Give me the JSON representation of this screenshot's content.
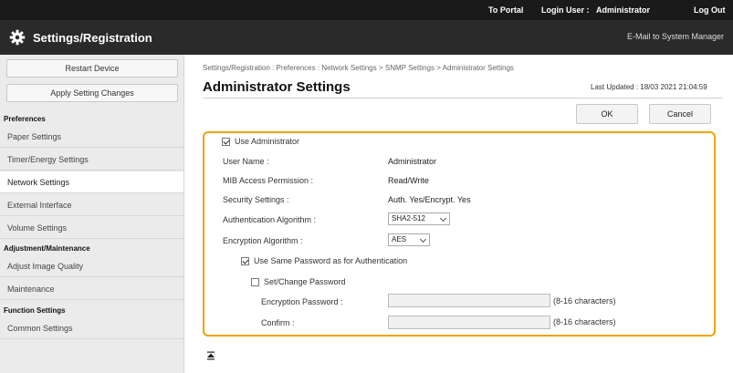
{
  "topbar": {
    "portal_link": "To Portal",
    "login_user_label": "Login User :",
    "login_user_name": "Administrator",
    "logout_link": "Log Out"
  },
  "titlebar": {
    "title": "Settings/Registration",
    "email_link": "E-Mail to System Manager"
  },
  "sidebar": {
    "restart_button": "Restart Device",
    "apply_button": "Apply Setting Changes",
    "categories": [
      {
        "label": "Preferences",
        "items": [
          "Paper Settings",
          "Timer/Energy Settings",
          "Network Settings",
          "External Interface",
          "Volume Settings"
        ]
      },
      {
        "label": "Adjustment/Maintenance",
        "items": [
          "Adjust Image Quality",
          "Maintenance"
        ]
      },
      {
        "label": "Function Settings",
        "items": [
          "Common Settings"
        ]
      }
    ],
    "active_item": "Network Settings"
  },
  "main": {
    "breadcrumb": "Settings/Registration : Preferences : Network Settings > SNMP Settings > Administrator Settings",
    "title": "Administrator Settings",
    "last_updated": "Last Updated : 18/03 2021 21:04:59",
    "ok_button": "OK",
    "cancel_button": "Cancel"
  },
  "form": {
    "use_admin_label": "Use Administrator",
    "use_admin_checked": true,
    "user_name_label": "User Name :",
    "user_name_value": "Administrator",
    "mib_label": "MIB Access Permission :",
    "mib_value": "Read/Write",
    "security_label": "Security Settings :",
    "security_value": "Auth. Yes/Encrypt. Yes",
    "auth_algo_label": "Authentication Algorithm :",
    "auth_algo_value": "SHA2-512",
    "enc_algo_label": "Encryption Algorithm :",
    "enc_algo_value": "AES",
    "same_pw_label": "Use Same Password as for Authentication",
    "same_pw_checked": true,
    "set_change_pw_label": "Set/Change Password",
    "set_change_pw_checked": false,
    "enc_pw_label": "Encryption Password :",
    "enc_pw_value": "",
    "enc_pw_hint": "(8-16 characters)",
    "confirm_label": "Confirm :",
    "confirm_value": "",
    "confirm_hint": "(8-16 characters)"
  },
  "icons": {
    "app_icon": "gear-icon",
    "scroll_top_icon": "scroll-to-top-icon"
  },
  "colors": {
    "highlight_border": "#f0a400",
    "topbar_bg": "#1a1a1a",
    "titlebar_bg": "#2a2a2a"
  }
}
